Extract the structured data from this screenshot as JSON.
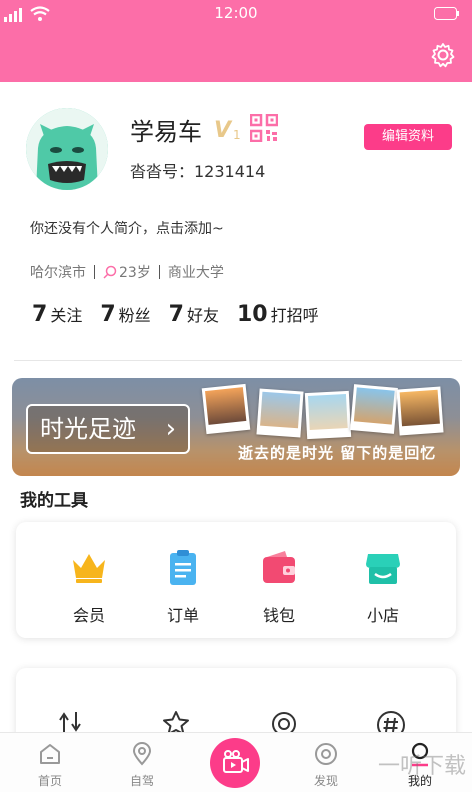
{
  "status_bar": {
    "time": "12:00"
  },
  "profile": {
    "name": "学易车",
    "vip_badge": "V",
    "vip_level": "1",
    "uid_label": "沓沓号：1231414",
    "edit_button": "编辑资料",
    "bio": "你还没有个人简介，点击添加~",
    "city": "哈尔滨市",
    "age": "23岁",
    "school": "商业大学"
  },
  "stats": [
    {
      "num": "7",
      "label": "关注"
    },
    {
      "num": "7",
      "label": "粉丝"
    },
    {
      "num": "7",
      "label": "好友"
    },
    {
      "num": "10",
      "label": "打招呼"
    }
  ],
  "banner": {
    "button_label": "时光足迹",
    "arrow": "›",
    "slogan": "逝去的是时光 留下的是回忆"
  },
  "tools": {
    "title": "我的工具",
    "items": [
      {
        "label": "会员",
        "icon": "crown-icon"
      },
      {
        "label": "订单",
        "icon": "order-icon"
      },
      {
        "label": "钱包",
        "icon": "wallet-icon"
      },
      {
        "label": "小店",
        "icon": "shop-icon"
      }
    ]
  },
  "tabbar": {
    "items": [
      {
        "label": "首页",
        "icon": "home-icon"
      },
      {
        "label": "自驾",
        "icon": "location-icon"
      },
      {
        "label": "发现",
        "icon": "discover-icon"
      },
      {
        "label": "我的",
        "icon": "profile-icon"
      }
    ]
  },
  "colors": {
    "header": "#fc6ea8",
    "accent": "#fc3c89",
    "vip": "#e8c88a"
  },
  "watermark": "一听下载"
}
